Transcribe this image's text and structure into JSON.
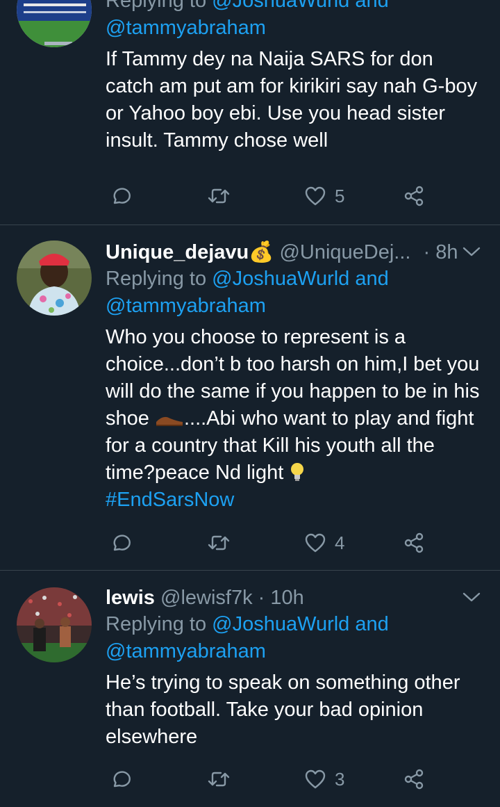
{
  "tweets": [
    {
      "replying_prefix": "Replying to",
      "replying_user": "@JoshuaWurld and",
      "replying_user2": "@tammyabraham",
      "text": "If Tammy dey na Naija SARS for don catch am put am for kirikiri say nah G-boy or Yahoo boy ebi. Use you head sister insult. Tammy chose well",
      "likes": "5"
    },
    {
      "display_name": "Unique_dejavu",
      "name_emoji": "💰",
      "handle": "@UniqueDej...",
      "time": "· 8h",
      "replying_prefix": "Replying to",
      "replying_user": "@JoshuaWurld and",
      "replying_user2": "@tammyabraham",
      "text_a": "Who you choose to represent is a choice...don’t b too harsh on him,I bet you will do the same if you happen to be in his shoe ",
      "text_b": "....Abi who want to play and fight for a country that Kill his youth all the time?peace Nd light ",
      "hashtag": "#EndSarsNow",
      "likes": "4"
    },
    {
      "display_name": "lewis",
      "handle": "@lewisf7k",
      "time": "· 10h",
      "replying_prefix": "Replying to",
      "replying_user": "@JoshuaWurld and",
      "replying_user2": "@tammyabraham",
      "text": "He’s trying to speak on something other than football. Take your bad opinion elsewhere",
      "likes": "3"
    }
  ],
  "icons": {
    "reply": "reply-icon",
    "retweet": "retweet-icon",
    "like": "heart-icon",
    "share": "share-icon",
    "more": "chevron-down-icon"
  },
  "colors": {
    "background": "#15202b",
    "divider": "#38444d",
    "secondary_text": "#8899a6",
    "link": "#1da1f2"
  }
}
